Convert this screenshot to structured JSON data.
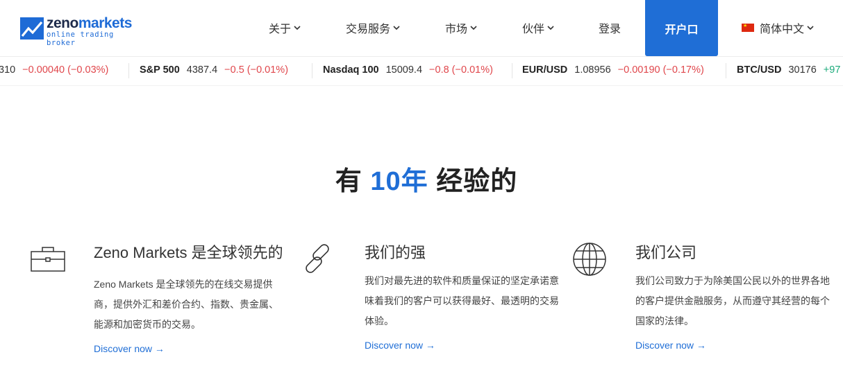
{
  "brand": {
    "name_part1": "zeno",
    "name_part2": "markets",
    "tagline": "online trading broker"
  },
  "nav": {
    "items": [
      {
        "label": "关于"
      },
      {
        "label": "交易服务"
      },
      {
        "label": "市场"
      },
      {
        "label": "伙伴"
      }
    ],
    "login": "登录",
    "open_account": "开户口",
    "language": "简体中文"
  },
  "ticker": [
    {
      "symbol": "",
      "price": "310",
      "change": "−0.00040 (−0.03%)",
      "direction": "down"
    },
    {
      "symbol": "S&P 500",
      "price": "4387.4",
      "change": "−0.5 (−0.01%)",
      "direction": "down"
    },
    {
      "symbol": "Nasdaq 100",
      "price": "15009.4",
      "change": "−0.8 (−0.01%)",
      "direction": "down"
    },
    {
      "symbol": "EUR/USD",
      "price": "1.08956",
      "change": "−0.00190 (−0.17%)",
      "direction": "down"
    },
    {
      "symbol": "BTC/USD",
      "price": "30176",
      "change": "+97",
      "direction": "up"
    }
  ],
  "heading": {
    "prefix": "有",
    "accent": "10年",
    "suffix": "经验的"
  },
  "features": [
    {
      "icon": "briefcase-icon",
      "title": "Zeno Markets 是全球领先的",
      "desc": "Zeno Markets 是全球领先的在线交易提供商，提供外汇和差价合约、指数、贵金属、能源和加密货币的交易。",
      "link": "Discover now →"
    },
    {
      "icon": "chain-link-icon",
      "title": "我们的强",
      "desc": "我们对最先进的软件和质量保证的坚定承诺意味着我们的客户可以获得最好、最透明的交易体验。",
      "link": "Discover now →"
    },
    {
      "icon": "globe-icon",
      "title": "我们公司",
      "desc": "我们公司致力于为除美国公民以外的世界各地的客户提供金融服务，从而遵守其经营的每个国家的法律。",
      "link": "Discover now →"
    }
  ],
  "colors": {
    "accent": "#1f6ed6",
    "negative": "#e0464b",
    "positive": "#1aaa7a"
  }
}
